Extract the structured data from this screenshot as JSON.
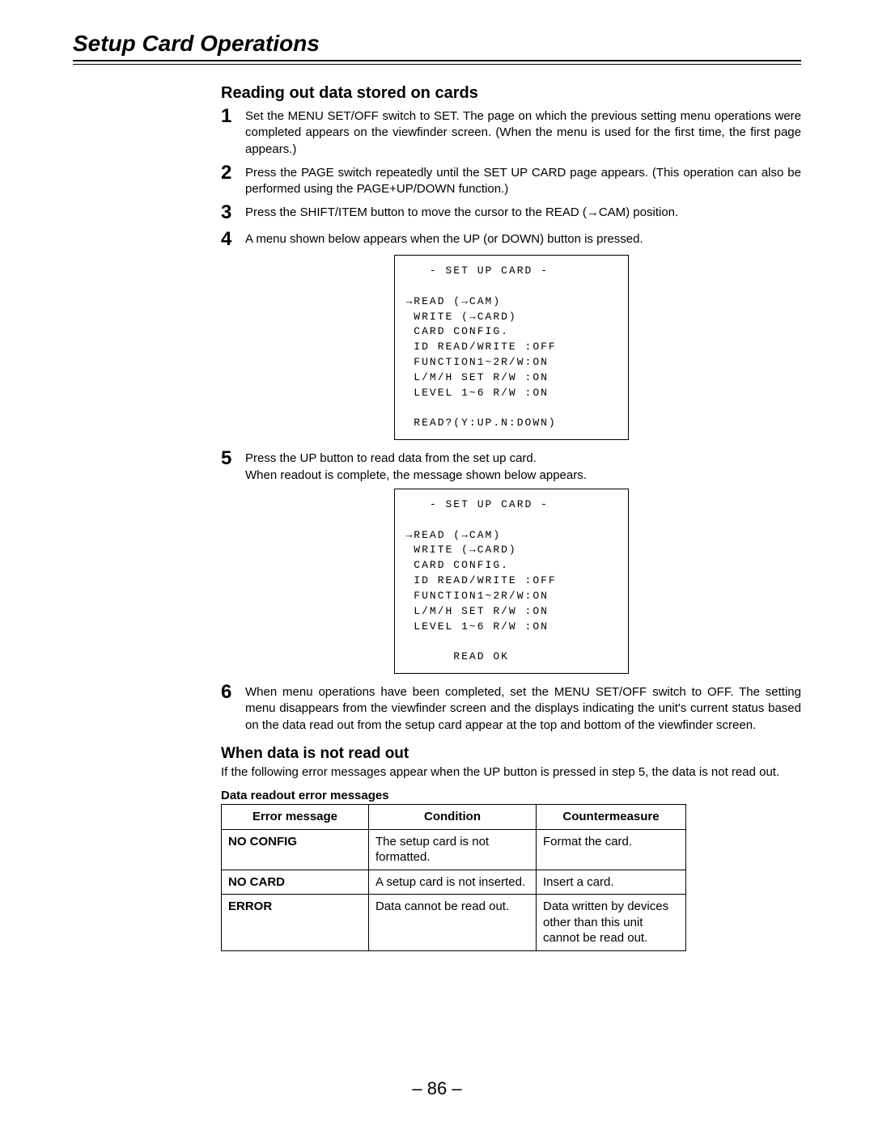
{
  "chapter_title": "Setup Card Operations",
  "section_heading": "Reading out data stored on cards",
  "steps": {
    "s1": {
      "num": "1",
      "text": "Set the MENU SET/OFF switch to SET. The page on which the previous setting menu operations were completed appears on the viewfinder screen. (When the menu is used for the first time, the first page appears.)"
    },
    "s2": {
      "num": "2",
      "text": "Press the PAGE switch repeatedly until the SET UP CARD page appears. (This operation can also be performed using the PAGE+UP/DOWN function.)"
    },
    "s3": {
      "num": "3",
      "text": "Press the SHIFT/ITEM button to move the cursor to the READ (→CAM) position."
    },
    "s4": {
      "num": "4",
      "text": "A menu shown below appears when the UP (or DOWN) button is pressed."
    },
    "s5": {
      "num": "5",
      "text": "Press the UP button to read data from the set up card.\nWhen readout is complete, the message shown below appears."
    },
    "s6": {
      "num": "6",
      "text": "When menu operations have been completed, set the MENU SET/OFF switch to OFF. The setting menu disappears from the viewfinder screen and the displays indicating the unit's current status based on the data read out from the setup card appear at the top and bottom of the viewfinder screen."
    }
  },
  "screen1": {
    "title": "   - SET UP CARD -",
    "l1": "→READ (→CAM)",
    "l2": " WRITE (→CARD)",
    "l3": " CARD CONFIG.",
    "l4": " ID READ/WRITE :OFF",
    "l5": " FUNCTION1~2R/W:ON",
    "l6": " L/M/H SET R/W :ON",
    "l7": " LEVEL 1~6 R/W :ON",
    "footer": " READ?(Y:UP.N:DOWN)"
  },
  "screen2": {
    "title": "   - SET UP CARD -",
    "l1": "→READ (→CAM)",
    "l2": " WRITE (→CARD)",
    "l3": " CARD CONFIG.",
    "l4": " ID READ/WRITE :OFF",
    "l5": " FUNCTION1~2R/W:ON",
    "l6": " L/M/H SET R/W :ON",
    "l7": " LEVEL 1~6 R/W :ON",
    "footer": "      READ OK"
  },
  "sub_heading": "When data is not read out",
  "sub_para": "If the following error messages appear when the UP button is pressed in step 5, the data is not read out.",
  "table_caption": "Data readout error messages",
  "table": {
    "headers": {
      "h1": "Error message",
      "h2": "Condition",
      "h3": "Countermeasure"
    },
    "rows": {
      "r1": {
        "msg": "NO CONFIG",
        "cond": "The setup card is not formatted.",
        "fix": "Format the card."
      },
      "r2": {
        "msg": "NO CARD",
        "cond": "A setup card is not inserted.",
        "fix": "Insert a card."
      },
      "r3": {
        "msg": "ERROR",
        "cond": "Data cannot be read out.",
        "fix": "Data written by devices other than this unit cannot be read out."
      }
    }
  },
  "page_number": "– 86 –"
}
